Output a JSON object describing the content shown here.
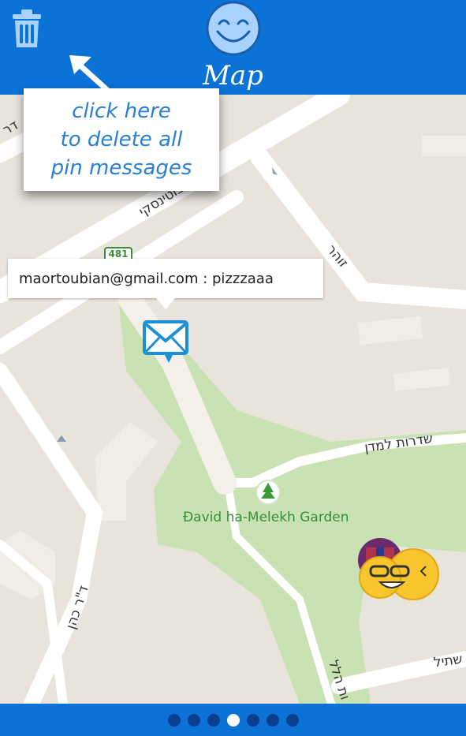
{
  "header": {
    "title": "Map",
    "trash_icon": "trash-icon",
    "logo_icon": "smiley-face-icon",
    "color": "#0b72d6"
  },
  "tooltip": {
    "text": "click here\nto delete all\npin messages",
    "arrow_icon": "arrow-up-left-icon"
  },
  "pin_message": {
    "text": "maortoubian@gmail.com : pizzzaaa",
    "icon": "envelope-icon"
  },
  "map": {
    "place_label": "Đavid ha-Melekh Garden",
    "place_icon": "tree-icon",
    "route_shield": "481",
    "streets": {
      "top_left": "דר",
      "diagonal_a": "דרך ז'בוטינסקי",
      "zohar": "זוהר",
      "sderot": "שדרות למדן",
      "dr_cohen": "ד\"ר כהן",
      "shtil": "שתיל",
      "hil": "ות הלל"
    },
    "avatars_icon": "user-avatars-icon"
  },
  "pager": {
    "count": 7,
    "active_index": 3
  }
}
